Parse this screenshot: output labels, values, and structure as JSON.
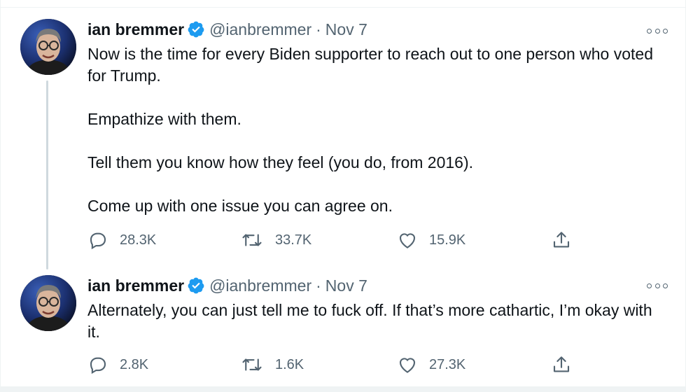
{
  "tweets": [
    {
      "author": {
        "display_name": "ian bremmer",
        "handle": "@ianbremmer",
        "verified": true,
        "avatar_icon": "avatar-photo"
      },
      "separator": "·",
      "date": "Nov 7",
      "paragraphs": [
        "Now is the time for every Biden supporter to reach out to one person who voted for Trump.",
        "Empathize with them.",
        "Tell them you know how they feel (you do, from 2016).",
        "Come up with one issue you can agree on."
      ],
      "actions": {
        "reply_count": "28.3K",
        "retweet_count": "33.7K",
        "like_count": "15.9K"
      }
    },
    {
      "author": {
        "display_name": "ian bremmer",
        "handle": "@ianbremmer",
        "verified": true,
        "avatar_icon": "avatar-photo"
      },
      "separator": "·",
      "date": "Nov 7",
      "paragraphs": [
        "Alternately, you can just tell me to fuck off. If that’s more cathartic, I’m okay with it."
      ],
      "actions": {
        "reply_count": "2.8K",
        "retweet_count": "1.6K",
        "like_count": "27.3K"
      }
    }
  ],
  "icons": {
    "verified": "verified-badge-icon",
    "more": "more-options-icon",
    "reply": "reply-icon",
    "retweet": "retweet-icon",
    "like": "heart-icon",
    "share": "share-icon"
  },
  "colors": {
    "text": "#0f1419",
    "secondary": "#536471",
    "verified": "#1d9bf0",
    "thread_line": "#cfd9de",
    "border": "#eff3f4"
  }
}
